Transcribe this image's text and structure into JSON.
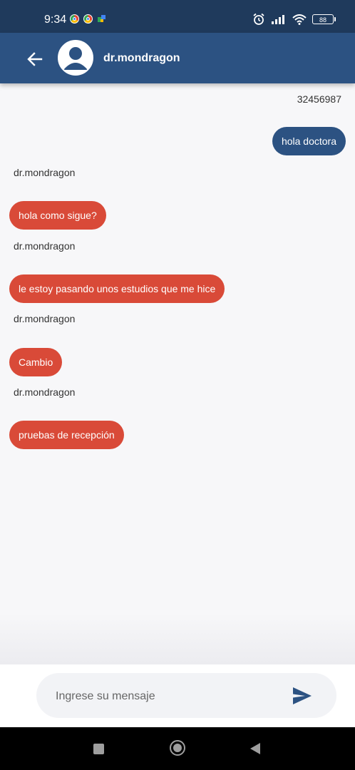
{
  "status": {
    "time": "9:34",
    "battery": "88"
  },
  "header": {
    "title": "dr.mondragon"
  },
  "chat": {
    "phone": "32456987",
    "messages": [
      {
        "direction": "out",
        "text": "hola doctora"
      },
      {
        "direction": "in",
        "sender": "dr.mondragon",
        "text": "hola como sigue?"
      },
      {
        "direction": "in",
        "sender": "dr.mondragon",
        "text": "le estoy pasando unos estudios que me hice"
      },
      {
        "direction": "in",
        "sender": "dr.mondragon",
        "text": "Cambio"
      },
      {
        "direction": "in",
        "sender": "dr.mondragon",
        "text": "pruebas de recepción"
      }
    ]
  },
  "composer": {
    "placeholder": "Ingrese su mensaje"
  },
  "colors": {
    "status_bar": "#1f3a5c",
    "app_bar": "#2c5282",
    "outgoing_bubble": "#2c5282",
    "incoming_bubble": "#d94a38"
  },
  "icons": [
    "back-arrow-icon",
    "avatar-icon",
    "send-icon",
    "alarm-icon",
    "signal-icon",
    "wifi-icon",
    "battery-icon",
    "chrome-icon",
    "nav-recents-icon",
    "nav-home-icon",
    "nav-back-icon"
  ]
}
